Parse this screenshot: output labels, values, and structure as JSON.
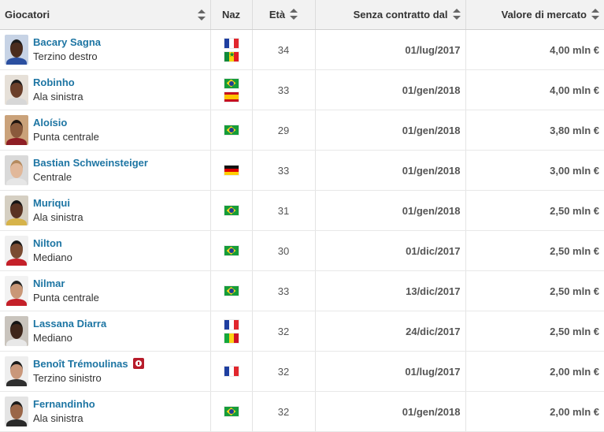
{
  "headers": {
    "player": "Giocatori",
    "nat": "Naz",
    "age": "Età",
    "contract": "Senza contratto dal",
    "value": "Valore di mercato"
  },
  "rows": [
    {
      "name": "Bacary Sagna",
      "position": "Terzino destro",
      "flags": [
        "france-flag-icon",
        "senegal-flag-icon"
      ],
      "age": "34",
      "contract_end": "01/lug/2017",
      "market_value": "4,00 mln €",
      "skin": "#4a2c1e",
      "hair": "#1b1b1b",
      "shirt": "#2b4fa0",
      "bg": "#c7d3e5"
    },
    {
      "name": "Robinho",
      "position": "Ala sinistra",
      "flags": [
        "brazil-flag-icon",
        "spain-flag-icon"
      ],
      "age": "33",
      "contract_end": "01/gen/2018",
      "market_value": "4,00 mln €",
      "skin": "#6b3f2a",
      "hair": "#1a1a1a",
      "shirt": "#d7d7d7",
      "bg": "#e6e0d8"
    },
    {
      "name": "Aloísio",
      "position": "Punta centrale",
      "flags": [
        "brazil-flag-icon"
      ],
      "age": "29",
      "contract_end": "01/gen/2018",
      "market_value": "3,80 mln €",
      "skin": "#8a5a3c",
      "hair": "#201510",
      "shirt": "#8e1e24",
      "bg": "#caa27a"
    },
    {
      "name": "Bastian Schweinsteiger",
      "position": "Centrale",
      "flags": [
        "germany-flag-icon"
      ],
      "age": "33",
      "contract_end": "01/gen/2018",
      "market_value": "3,00 mln €",
      "skin": "#e1b89a",
      "hair": "#b48a5e",
      "shirt": "#e6e6e6",
      "bg": "#d9d9d9"
    },
    {
      "name": "Muriqui",
      "position": "Ala sinistra",
      "flags": [
        "brazil-flag-icon"
      ],
      "age": "31",
      "contract_end": "01/gen/2018",
      "market_value": "2,50 mln €",
      "skin": "#5a3322",
      "hair": "#151515",
      "shirt": "#d6b34a",
      "bg": "#d5cfc2"
    },
    {
      "name": "Nilton",
      "position": "Mediano",
      "flags": [
        "brazil-flag-icon"
      ],
      "age": "30",
      "contract_end": "01/dic/2017",
      "market_value": "2,50 mln €",
      "skin": "#7a4b32",
      "hair": "#171717",
      "shirt": "#c42029",
      "bg": "#f0f0f0"
    },
    {
      "name": "Nilmar",
      "position": "Punta centrale",
      "flags": [
        "brazil-flag-icon"
      ],
      "age": "33",
      "contract_end": "13/dic/2017",
      "market_value": "2,50 mln €",
      "skin": "#c99777",
      "hair": "#222",
      "shirt": "#c42029",
      "bg": "#f2f2f2"
    },
    {
      "name": "Lassana Diarra",
      "position": "Mediano",
      "flags": [
        "france-flag-icon",
        "mali-flag-icon"
      ],
      "age": "32",
      "contract_end": "24/dic/2017",
      "market_value": "2,50 mln €",
      "skin": "#3f261a",
      "hair": "#141414",
      "shirt": "#e8e8e8",
      "bg": "#c9c4bd"
    },
    {
      "name": "Benoît Trémoulinas",
      "position": "Terzino sinistro",
      "flags": [
        "france-flag-icon"
      ],
      "age": "32",
      "contract_end": "01/lug/2017",
      "market_value": "2,00 mln €",
      "skin": "#c9977a",
      "hair": "#1b1b1b",
      "shirt": "#2f2f2f",
      "bg": "#eeeeee",
      "badge": "injury-badge-icon"
    },
    {
      "name": "Fernandinho",
      "position": "Ala sinistra",
      "flags": [
        "brazil-flag-icon"
      ],
      "age": "32",
      "contract_end": "01/gen/2018",
      "market_value": "2,00 mln €",
      "skin": "#9a6648",
      "hair": "#1c1c1c",
      "shirt": "#2a2a2a",
      "bg": "#e4e4e4"
    }
  ]
}
